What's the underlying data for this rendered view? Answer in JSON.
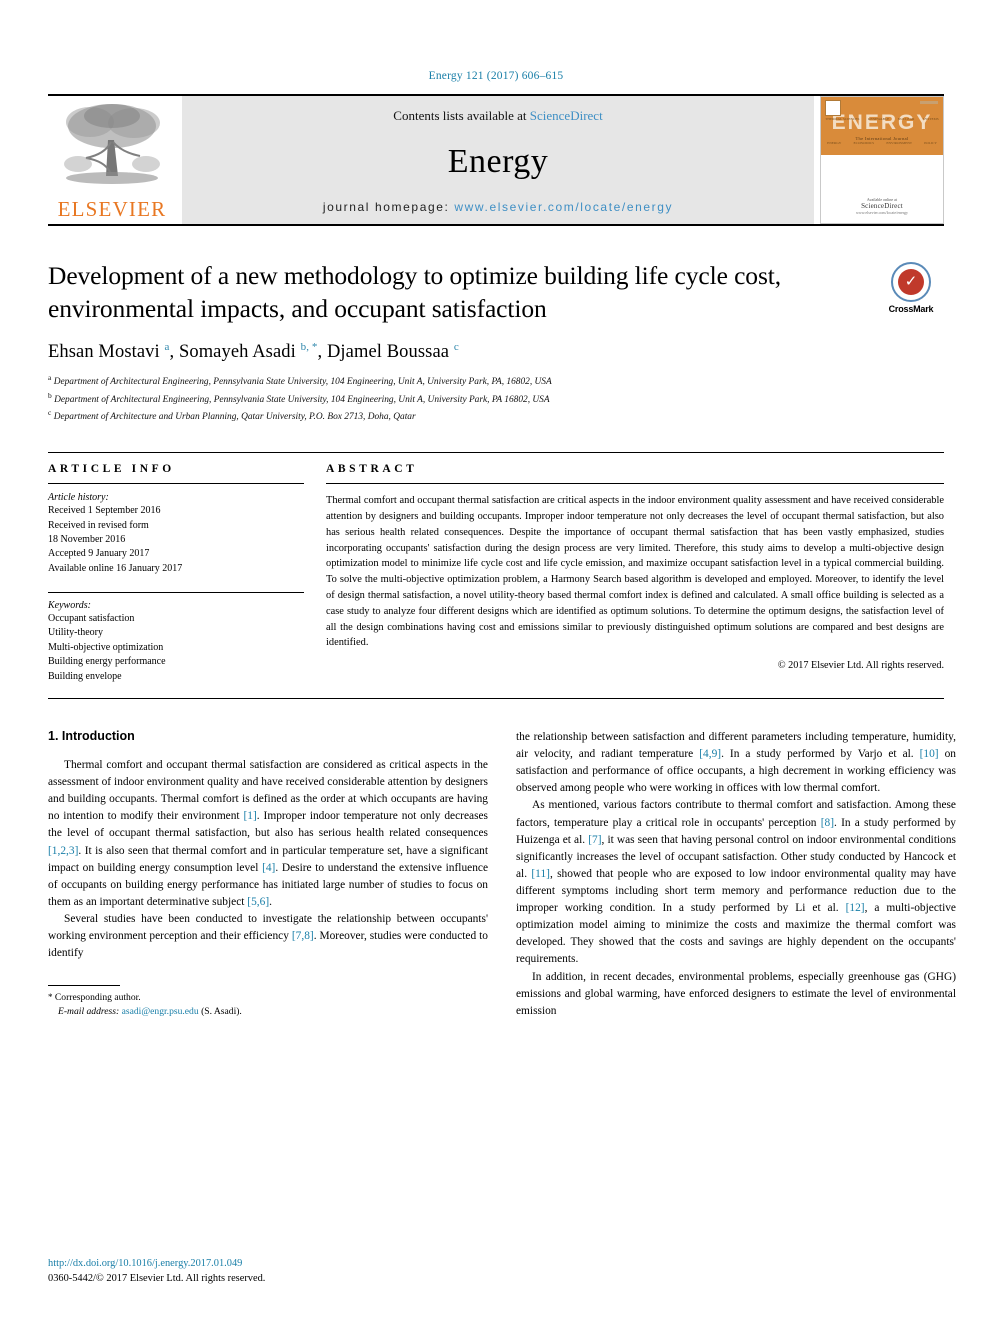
{
  "running_head": "Energy 121 (2017) 606–615",
  "masthead": {
    "elsevier_wordmark": "ELSEVIER",
    "contents_prefix": "Contents lists available at ",
    "sciencedirect": "ScienceDirect",
    "journal_title": "Energy",
    "homepage_prefix": "journal homepage: ",
    "homepage_url": "www.elsevier.com/locate/energy",
    "cover": {
      "title": "ENERGY",
      "subtitle": "The International Journal",
      "top_labels": [
        "THERMAL SCIENCES",
        "RENEWABLE",
        "NUCLEAR",
        "SYSTEMS"
      ],
      "bottom_labels": [
        "ENERGY",
        "ECONOMICS",
        "ENVIRONMENT",
        "POLICY"
      ],
      "foot_small": "Available online at",
      "foot_brand": "ScienceDirect",
      "foot_url": "www.elsevier.com/locate/energy"
    }
  },
  "article": {
    "title": "Development of a new methodology to optimize building life cycle cost, environmental impacts, and occupant satisfaction",
    "authors_html": "Ehsan Mostavi <sup>a</sup>, Somayeh Asadi <sup>b, *</sup>, Djamel Boussaa <sup>c</sup>",
    "affiliations": [
      {
        "marker": "a",
        "text": "Department of Architectural Engineering, Pennsylvania State University, 104 Engineering, Unit A, University Park, PA, 16802, USA"
      },
      {
        "marker": "b",
        "text": "Department of Architectural Engineering, Pennsylvania State University, 104 Engineering, Unit A, University Park, PA 16802, USA"
      },
      {
        "marker": "c",
        "text": "Department of Architecture and Urban Planning, Qatar University, P.O. Box 2713, Doha, Qatar"
      }
    ],
    "crossmark_label": "CrossMark"
  },
  "article_info": {
    "heading": "ARTICLE INFO",
    "history_label": "Article history:",
    "history": [
      "Received 1 September 2016",
      "Received in revised form",
      "18 November 2016",
      "Accepted 9 January 2017",
      "Available online 16 January 2017"
    ],
    "keywords_label": "Keywords:",
    "keywords": [
      "Occupant satisfaction",
      "Utility-theory",
      "Multi-objective optimization",
      "Building energy performance",
      "Building envelope"
    ]
  },
  "abstract": {
    "heading": "ABSTRACT",
    "text": "Thermal comfort and occupant thermal satisfaction are critical aspects in the indoor environment quality assessment and have received considerable attention by designers and building occupants. Improper indoor temperature not only decreases the level of occupant thermal satisfaction, but also has serious health related consequences. Despite the importance of occupant thermal satisfaction that has been vastly emphasized, studies incorporating occupants' satisfaction during the design process are very limited. Therefore, this study aims to develop a multi-objective design optimization model to minimize life cycle cost and life cycle emission, and maximize occupant satisfaction level in a typical commercial building. To solve the multi-objective optimization problem, a Harmony Search based algorithm is developed and employed. Moreover, to identify the level of design thermal satisfaction, a novel utility-theory based thermal comfort index is defined and calculated. A small office building is selected as a case study to analyze four different designs which are identified as optimum solutions. To determine the optimum designs, the satisfaction level of all the design combinations having cost and emissions similar to previously distinguished optimum solutions are compared and best designs are identified.",
    "copyright": "© 2017 Elsevier Ltd. All rights reserved."
  },
  "body": {
    "section_number_title": "1. Introduction",
    "left_paragraphs": [
      "Thermal comfort and occupant thermal satisfaction are considered as critical aspects in the assessment of indoor environment quality and have received considerable attention by designers and building occupants. Thermal comfort is defined as the order at which occupants are having no intention to modify their environment [1]. Improper indoor temperature not only decreases the level of occupant thermal satisfaction, but also has serious health related consequences [1,2,3]. It is also seen that thermal comfort and in particular temperature set, have a significant impact on building energy consumption level [4]. Desire to understand the extensive influence of occupants on building energy performance has initiated large number of studies to focus on them as an important determinative subject [5,6].",
      "Several studies have been conducted to investigate the relationship between occupants' working environment perception and their efficiency [7,8]. Moreover, studies were conducted to identify"
    ],
    "right_paragraphs": [
      "the relationship between satisfaction and different parameters including temperature, humidity, air velocity, and radiant temperature [4,9]. In a study performed by Varjo et al. [10] on satisfaction and performance of office occupants, a high decrement in working efficiency was observed among people who were working in offices with low thermal comfort.",
      "As mentioned, various factors contribute to thermal comfort and satisfaction. Among these factors, temperature play a critical role in occupants' perception [8]. In a study performed by Huizenga et al. [7], it was seen that having personal control on indoor environmental conditions significantly increases the level of occupant satisfaction. Other study conducted by Hancock et al. [11], showed that people who are exposed to low indoor environmental quality may have different symptoms including short term memory and performance reduction due to the improper working condition. In a study performed by Li et al. [12], a multi-objective optimization model aiming to minimize the costs and maximize the thermal comfort was developed. They showed that the costs and savings are highly dependent on the occupants' requirements.",
      "In addition, in recent decades, environmental problems, especially greenhouse gas (GHG) emissions and global warming, have enforced designers to estimate the level of environmental emission"
    ]
  },
  "footer": {
    "corresponding_marker": "*",
    "corresponding_label": "Corresponding author.",
    "email_label": "E-mail address:",
    "email": "asadi@engr.psu.edu",
    "email_suffix": "(S. Asadi).",
    "doi": "http://dx.doi.org/10.1016/j.energy.2017.01.049",
    "issn_line": "0360-5442/© 2017 Elsevier Ltd. All rights reserved."
  },
  "colors": {
    "link_blue": "#1a7fa8",
    "sciencedirect_blue": "#3f8fc4",
    "elsevier_orange": "#E87722",
    "cover_orange": "#D98B3A"
  }
}
